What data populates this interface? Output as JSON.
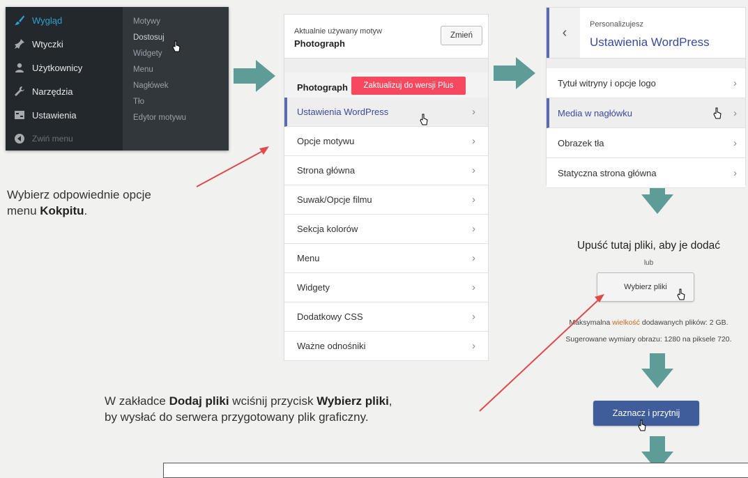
{
  "admin_menu": {
    "items": [
      {
        "label": "Wygląd",
        "icon": "paintbrush-icon",
        "active": true
      },
      {
        "label": "Wtyczki",
        "icon": "plugin-icon"
      },
      {
        "label": "Użytkownicy",
        "icon": "users-icon"
      },
      {
        "label": "Narzędzia",
        "icon": "wrench-icon"
      },
      {
        "label": "Ustawienia",
        "icon": "settings-icon"
      },
      {
        "label": "Zwiń menu",
        "icon": "collapse-icon"
      }
    ],
    "submenu": [
      "Motywy",
      "Dostosuj",
      "Widgety",
      "Menu",
      "Nagłówek",
      "Tło",
      "Edytor motywu"
    ]
  },
  "customizer": {
    "current_theme_caption": "Aktualnie używany motyw",
    "current_theme_name": "Photograph",
    "change_button": "Zmień",
    "theme_row_label": "Photograph",
    "upgrade_badge": "Zaktualizuj do wersji Plus",
    "sections": [
      "Ustawienia WordPress",
      "Opcje motywu",
      "Strona główna",
      "Suwak/Opcje filmu",
      "Sekcja kolorów",
      "Menu",
      "Widgety",
      "Dodatkowy CSS",
      "Ważne odnośniki"
    ]
  },
  "site_settings": {
    "caption": "Personalizujesz",
    "title": "Ustawienia WordPress",
    "rows": [
      "Tytuł witryny i opcje logo",
      "Media w nagłówku",
      "Obrazek tła",
      "Statyczna strona główna"
    ]
  },
  "upload": {
    "drop_text": "Upuść tutaj pliki, aby je dodać",
    "or_text": "lub",
    "select_button": "Wybierz pliki",
    "max_size_prefix": "Maksymalna ",
    "max_size_highlight": "wielkość",
    "max_size_suffix": " dodawanych plików: 2 GB.",
    "suggested": "Sugerowane wymiary obrazu: 1280 na piksele 720."
  },
  "crop_button": "Zaznacz i przytnij",
  "captions": {
    "cap1_line1": "Wybierz odpowiednie opcje",
    "cap1_line2_prefix": "menu ",
    "cap1_bold": "Kokpitu",
    "cap1_suffix": ".",
    "cap2_prefix": "W zakładce ",
    "cap2_bold1": "Dodaj pliki",
    "cap2_mid": " wciśnij przycisk ",
    "cap2_bold2": "Wybierz pliki",
    "cap2_suffix": ",",
    "cap2_line2": "by wysłać do serwera przygotowany plik graficzny."
  },
  "colors": {
    "arrow": "#5e9c98",
    "callout_line": "#e04a4a",
    "accent": "#3a4aa0",
    "upgrade_badge": "#f6485e"
  }
}
